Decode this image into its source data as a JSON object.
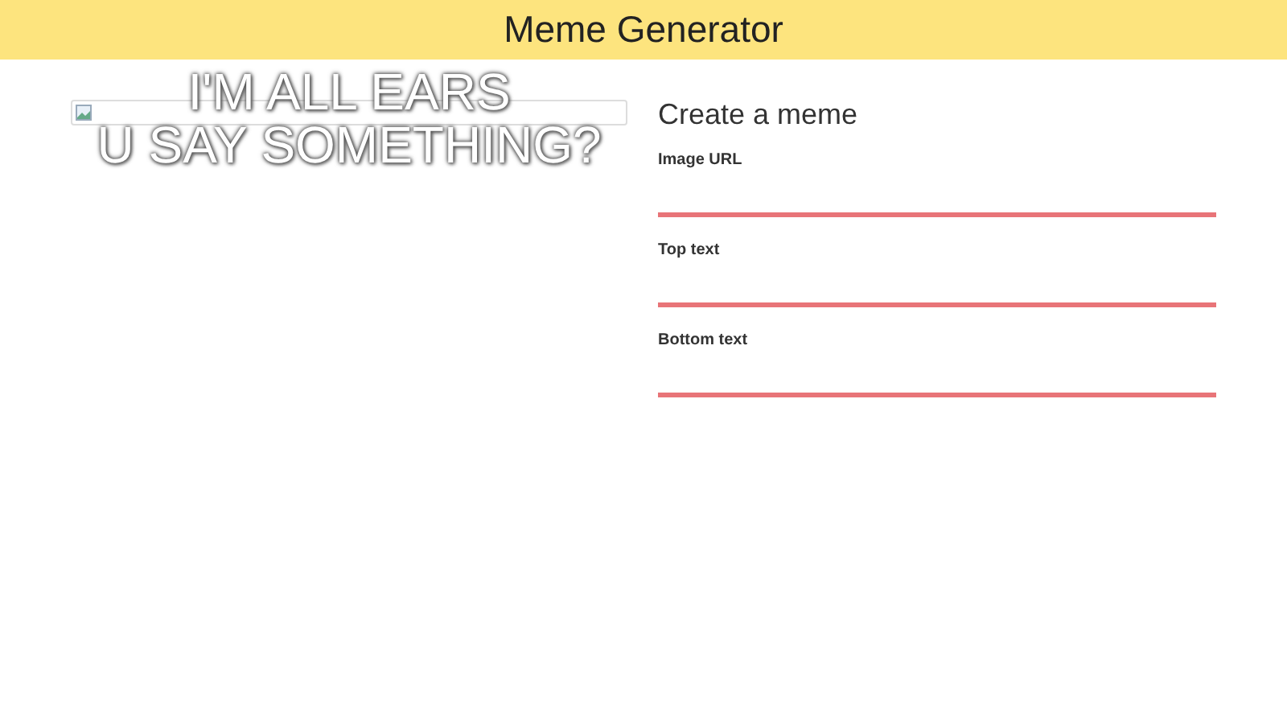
{
  "header": {
    "title": "Meme Generator"
  },
  "preview": {
    "top_text": "I'M ALL EARS",
    "bottom_text": "U SAY SOMETHING?"
  },
  "form": {
    "heading": "Create a meme",
    "fields": [
      {
        "label": "Image URL"
      },
      {
        "label": "Top text"
      },
      {
        "label": "Bottom text"
      }
    ]
  }
}
